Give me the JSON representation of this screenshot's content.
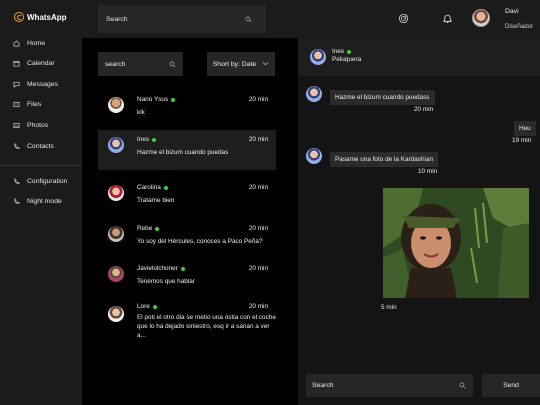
{
  "app": {
    "title": "WhatsApp"
  },
  "sidebar": {
    "items": [
      {
        "label": "Home",
        "icon": "home-icon"
      },
      {
        "label": "Calendar",
        "icon": "calendar-icon"
      },
      {
        "label": "Messages",
        "icon": "chat-icon"
      },
      {
        "label": "Files",
        "icon": "folder-icon"
      },
      {
        "label": "Photos",
        "icon": "image-icon"
      },
      {
        "label": "Contacts",
        "icon": "phone-icon"
      }
    ],
    "bottom_items": [
      {
        "label": "Configuration",
        "icon": "phone-icon"
      },
      {
        "label": "Night mode",
        "icon": "phone-icon"
      }
    ]
  },
  "header": {
    "search_placeholder": "Search",
    "user": {
      "name": "Davi",
      "role": "Diseñador"
    }
  },
  "chat_list": {
    "search_placeholder": "search",
    "sort_label": "Short by: Date",
    "chats": [
      {
        "name": "Nano Ysus",
        "online": true,
        "time": "20 min",
        "message": "klk"
      },
      {
        "name": "Ines",
        "online": true,
        "time": "20 min",
        "message": "Hazme el bizum cuando puedas"
      },
      {
        "name": "Carolina",
        "online": true,
        "time": "20 min",
        "message": "Tratame bien"
      },
      {
        "name": "Rebe",
        "online": true,
        "time": "20 min",
        "message": "Yo soy del Hércules, conoces a Paco Peña?"
      },
      {
        "name": "Javielolchoner",
        "online": true,
        "time": "20 min",
        "message": "Tenemos que hablar"
      },
      {
        "name": "Lore",
        "online": true,
        "time": "20 min",
        "message": "El poti el otro dia se metio una ostia con el coche que lo ha dejado siniestro, esq ir a sanan a ver a..."
      }
    ]
  },
  "conversation": {
    "contact_name": "Ines",
    "contact_status": "Peluquera",
    "messages": [
      {
        "text": "Hazme el bizum cuando puedass",
        "time": "20 min",
        "from": "contact"
      },
      {
        "text": "Heu",
        "time": "19 min",
        "from": "me"
      },
      {
        "text": "Pasame una foto de la Kardashian",
        "time": "10 min",
        "from": "contact"
      },
      {
        "text": "",
        "time": "5 min",
        "from": "me",
        "type": "photo"
      }
    ],
    "input_placeholder": "Search",
    "send_label": "Send"
  },
  "colors": {
    "accent": "#f0a020",
    "online": "#3ad13a",
    "panel": "#1b1b1b",
    "bubble": "#2b2b2b"
  }
}
